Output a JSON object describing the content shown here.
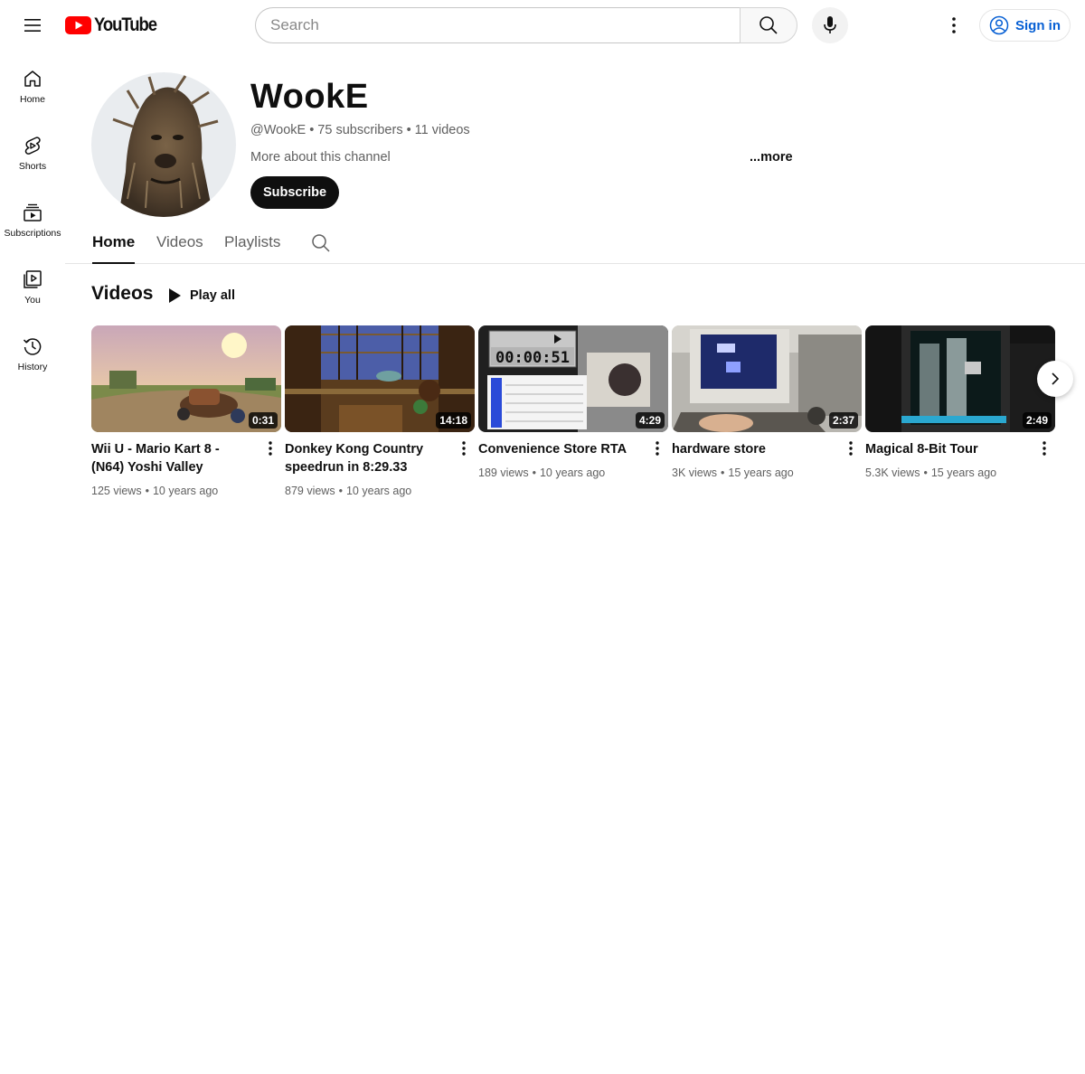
{
  "header": {
    "logo_text": "YouTube",
    "search_placeholder": "Search",
    "sign_in_label": "Sign in",
    "brand_color": "#ff0000",
    "link_color": "#065fd4"
  },
  "guide": {
    "items": [
      {
        "label": "Home",
        "icon": "home-icon"
      },
      {
        "label": "Shorts",
        "icon": "shorts-icon"
      },
      {
        "label": "Subscriptions",
        "icon": "subscriptions-icon"
      },
      {
        "label": "You",
        "icon": "you-icon"
      },
      {
        "label": "History",
        "icon": "history-icon"
      }
    ]
  },
  "channel": {
    "name": "WookE",
    "handle": "@WookE",
    "subscribers": "75 subscribers",
    "videos_count": "11 videos",
    "separator": "•",
    "about": "More about this channel",
    "more_label": "...more",
    "subscribe_label": "Subscribe"
  },
  "tabs": [
    {
      "label": "Home",
      "active": true
    },
    {
      "label": "Videos",
      "active": false
    },
    {
      "label": "Playlists",
      "active": false
    }
  ],
  "shelf": {
    "title": "Videos",
    "play_all_label": "Play all",
    "videos": [
      {
        "title": "Wii U - Mario Kart 8 - (N64) Yoshi Valley",
        "duration": "0:31",
        "views": "125 views",
        "age": "10 years ago"
      },
      {
        "title": "Donkey Kong Country speedrun in 8:29.33",
        "duration": "14:18",
        "views": "879 views",
        "age": "10 years ago"
      },
      {
        "title": "Convenience Store RTA",
        "duration": "4:29",
        "views": "189 views",
        "age": "10 years ago",
        "thumb_timer": "00:00:51"
      },
      {
        "title": "hardware store",
        "duration": "2:37",
        "views": "3K views",
        "age": "15 years ago"
      },
      {
        "title": "Magical 8-Bit Tour",
        "duration": "2:49",
        "views": "5.3K views",
        "age": "15 years ago"
      }
    ]
  }
}
